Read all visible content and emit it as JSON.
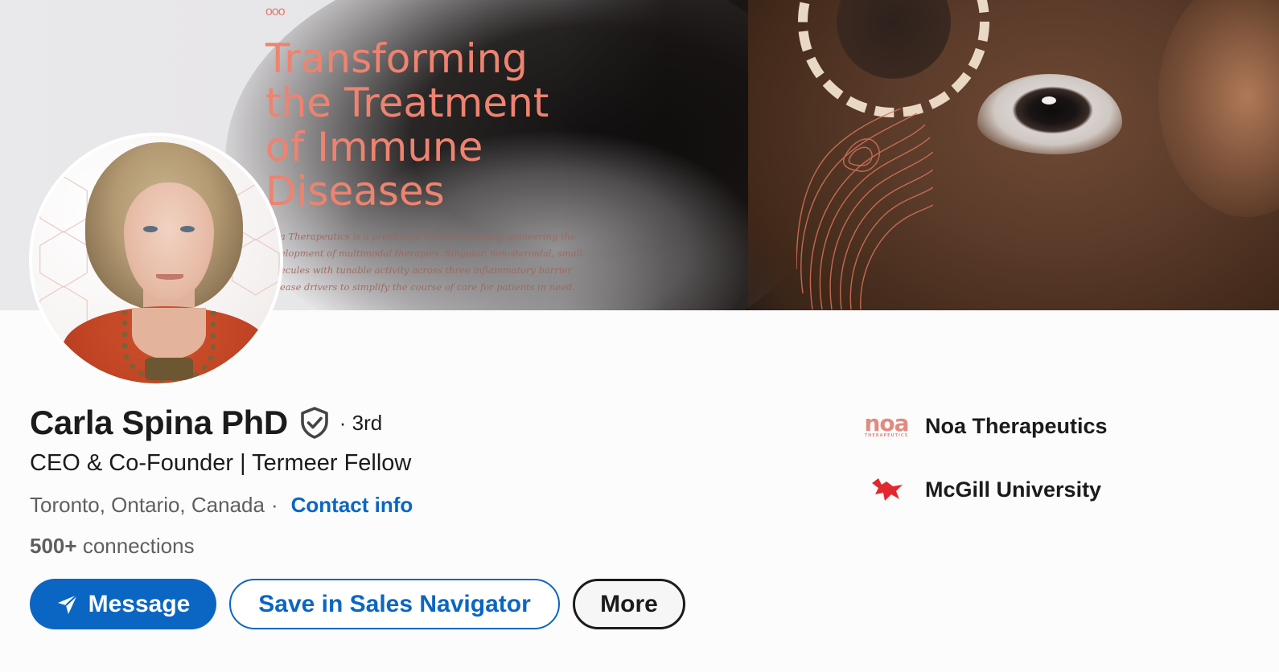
{
  "banner": {
    "dots": "ooo",
    "headline": "Transforming\nthe Treatment\nof Immune\nDiseases",
    "blurb": "a Therapeutics is a preclinical biotech company pioneering the\nelopment of multimodal therapies. Singular, non-steroidal, small\necules with tunable activity across three inflammatory barrier\nease drivers to simplify the course of care for patients in need."
  },
  "profile": {
    "name": "Carla Spina PhD",
    "verified_icon": "verified-shield-icon",
    "degree": "· 3rd",
    "headline": "CEO & Co-Founder | Termeer Fellow",
    "location": "Toronto, Ontario, Canada",
    "separator": "·",
    "contact_info": "Contact info",
    "connections_count": "500+",
    "connections_label": "connections"
  },
  "actions": {
    "message": "Message",
    "save": "Save in Sales Navigator",
    "more": "More"
  },
  "organizations": [
    {
      "name": "Noa Therapeutics",
      "logo_text": "noa",
      "logo_subtext": "THERAPEUTICS",
      "logo_color": "#e38a80"
    },
    {
      "name": "McGill University",
      "logo": "red-bird-icon",
      "logo_color": "#e0282e"
    }
  ],
  "colors": {
    "accent": "#0a66c2",
    "headline_coral": "#ee8370",
    "text": "#1b1b1b",
    "muted": "#5f5f5f"
  }
}
